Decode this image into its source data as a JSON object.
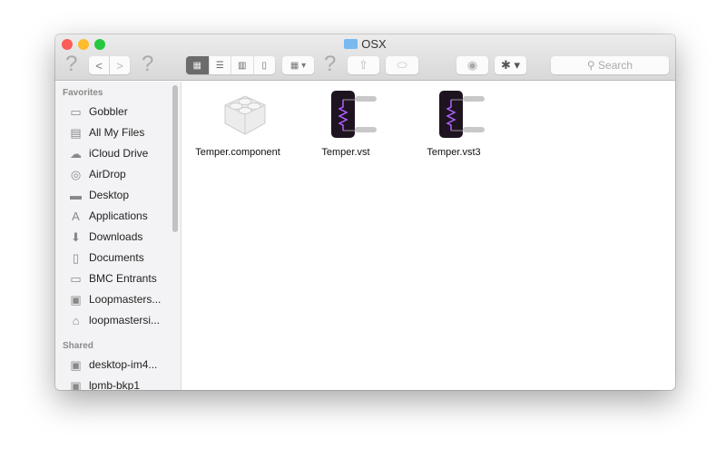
{
  "window": {
    "title": "OSX"
  },
  "toolbar": {
    "help": "?",
    "back": "<",
    "forward": ">",
    "search_placeholder": "Search",
    "views": [
      "icon",
      "list",
      "column",
      "coverflow"
    ]
  },
  "sidebar": {
    "favorites_header": "Favorites",
    "favorites": [
      {
        "label": "Gobbler",
        "icon": "folder-icon"
      },
      {
        "label": "All My Files",
        "icon": "all-files-icon"
      },
      {
        "label": "iCloud Drive",
        "icon": "cloud-icon"
      },
      {
        "label": "AirDrop",
        "icon": "airdrop-icon"
      },
      {
        "label": "Desktop",
        "icon": "desktop-icon"
      },
      {
        "label": "Applications",
        "icon": "applications-icon"
      },
      {
        "label": "Downloads",
        "icon": "download-icon"
      },
      {
        "label": "Documents",
        "icon": "documents-icon"
      },
      {
        "label": "BMC Entrants",
        "icon": "folder-icon"
      },
      {
        "label": "Loopmasters...",
        "icon": "drive-icon"
      },
      {
        "label": "loopmastersi...",
        "icon": "home-icon"
      }
    ],
    "shared_header": "Shared",
    "shared": [
      {
        "label": "desktop-im4...",
        "icon": "computer-icon"
      },
      {
        "label": "lpmb-bkp1",
        "icon": "computer-icon"
      }
    ]
  },
  "files": [
    {
      "name": "Temper.component",
      "type": "component"
    },
    {
      "name": "Temper.vst",
      "type": "vst"
    },
    {
      "name": "Temper.vst3",
      "type": "vst"
    }
  ],
  "colors": {
    "close": "#fc5d57",
    "minimize": "#fdbb2e",
    "zoom": "#27c840"
  }
}
